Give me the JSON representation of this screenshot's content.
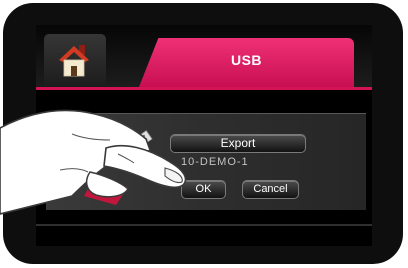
{
  "header": {
    "home_icon": "home-icon",
    "active_tab_label": "USB"
  },
  "dialog": {
    "drive_icon": "usb-drive-icon",
    "export_label": "Export",
    "file_name": "10-DEMO-1",
    "ok_label": "OK",
    "cancel_label": "Cancel"
  },
  "colors": {
    "accent": "#E0185F",
    "bezel": "#0E0E0E",
    "panel": "#333333"
  }
}
